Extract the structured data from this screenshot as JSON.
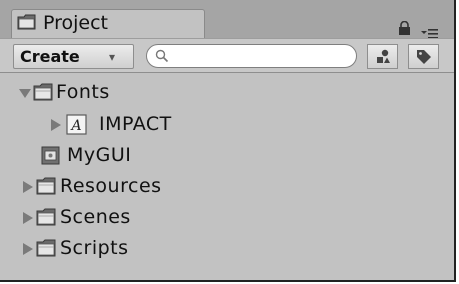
{
  "panel": {
    "tab_label": "Project",
    "tab_icon": "folder-icon",
    "lock_icon": "lock-icon",
    "menu_icon": "panel-menu-icon"
  },
  "toolbar": {
    "create_label": "Create",
    "create_caret": "▾",
    "search_placeholder": "",
    "search_value": "",
    "filter_by_type_icon": "filter-by-type-icon",
    "filter_by_label_icon": "filter-by-label-icon"
  },
  "tree": {
    "items": [
      {
        "label": "Fonts",
        "icon": "folder-icon",
        "expanded": true,
        "depth": 0
      },
      {
        "label": "IMPACT",
        "icon": "font-asset-icon",
        "expanded": false,
        "depth": 1
      },
      {
        "label": "MyGUI",
        "icon": "gui-skin-icon",
        "expanded": null,
        "depth": 0
      },
      {
        "label": "Resources",
        "icon": "folder-icon",
        "expanded": false,
        "depth": 0
      },
      {
        "label": "Scenes",
        "icon": "folder-icon",
        "expanded": false,
        "depth": 0
      },
      {
        "label": "Scripts",
        "icon": "folder-icon",
        "expanded": false,
        "depth": 0
      }
    ]
  },
  "colors": {
    "panel_bg": "#c2c2c2",
    "tabbar_bg": "#a5a5a5",
    "folder_fill": "#6a6a6a",
    "arrow": "#7a7a7a"
  }
}
